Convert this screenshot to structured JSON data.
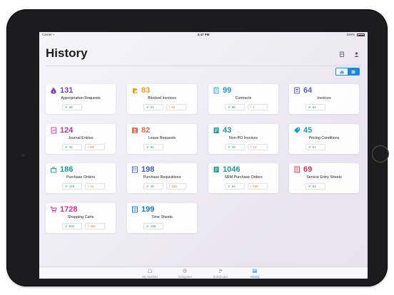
{
  "status": {
    "carrier": "Carrier ≈",
    "time": "4:47 PM",
    "battery": "100%"
  },
  "page": {
    "title": "History"
  },
  "header_icons": {
    "left": "document-icon",
    "right": "person-icon"
  },
  "view_toggle": {
    "left": "tile-view-icon",
    "right": "list-view-icon",
    "active": "right"
  },
  "tiles": [
    {
      "count": "131",
      "label": "Appropriation Requests",
      "ok": "88",
      "warn": "",
      "color": "#7b3fa0",
      "icon": "money-bag-icon"
    },
    {
      "count": "83",
      "label": "Blocked Invoices",
      "ok": "21",
      "warn": "62",
      "color": "#e6a117",
      "icon": "blocked-invoice-icon"
    },
    {
      "count": "99",
      "label": "Contracts",
      "ok": "98",
      "warn": "1",
      "color": "#1a9bbf",
      "icon": "contract-icon"
    },
    {
      "count": "64",
      "label": "Invoices",
      "ok": "64",
      "warn": "",
      "color": "#5b5bbf",
      "icon": "invoice-icon"
    },
    {
      "count": "124",
      "label": "Journal Entries",
      "ok": "31",
      "warn": "93",
      "color": "#c2349a",
      "icon": "journal-icon"
    },
    {
      "count": "82",
      "label": "Leave Requests",
      "ok": "82",
      "warn": "",
      "color": "#e8674a",
      "icon": "leave-request-icon"
    },
    {
      "count": "43",
      "label": "Non-PO Invoices",
      "ok": "29",
      "warn": "14",
      "color": "#1a9a8a",
      "icon": "non-po-invoice-icon"
    },
    {
      "count": "45",
      "label": "Pricing Conditions",
      "ok": "21",
      "warn": "",
      "color": "#1a9bbf",
      "icon": "price-tag-icon"
    },
    {
      "count": "186",
      "label": "Purchase Orders",
      "ok": "145",
      "warn": "41",
      "color": "#1a9a8a",
      "icon": "shopping-bag-icon"
    },
    {
      "count": "198",
      "label": "Purchase Requisitions",
      "ok": "26",
      "warn": "124",
      "color": "#3a5bb5",
      "icon": "requisition-icon"
    },
    {
      "count": "1046",
      "label": "SRM Purchase Orders",
      "ok": "64",
      "warn": "939",
      "color": "#1a9a8a",
      "icon": "srm-order-icon"
    },
    {
      "count": "69",
      "label": "Service Entry Sheets",
      "ok": "64",
      "warn": "",
      "color": "#c2345a",
      "icon": "service-sheet-icon"
    },
    {
      "count": "1728",
      "label": "Shopping Carts",
      "ok": "832",
      "warn": "226",
      "color": "#c2349a",
      "icon": "shopping-cart-icon"
    },
    {
      "count": "199",
      "label": "Time Sheets",
      "ok": "196",
      "warn": "",
      "color": "#1a7bbf",
      "icon": "time-sheet-icon"
    }
  ],
  "tabs": [
    {
      "label": "My Worklist",
      "icon": "inbox-icon",
      "active": false
    },
    {
      "label": "Delegated",
      "icon": "delegated-icon",
      "active": false
    },
    {
      "label": "Substitutes",
      "icon": "substitutes-icon",
      "active": false
    },
    {
      "label": "History",
      "icon": "history-icon",
      "active": true
    }
  ]
}
